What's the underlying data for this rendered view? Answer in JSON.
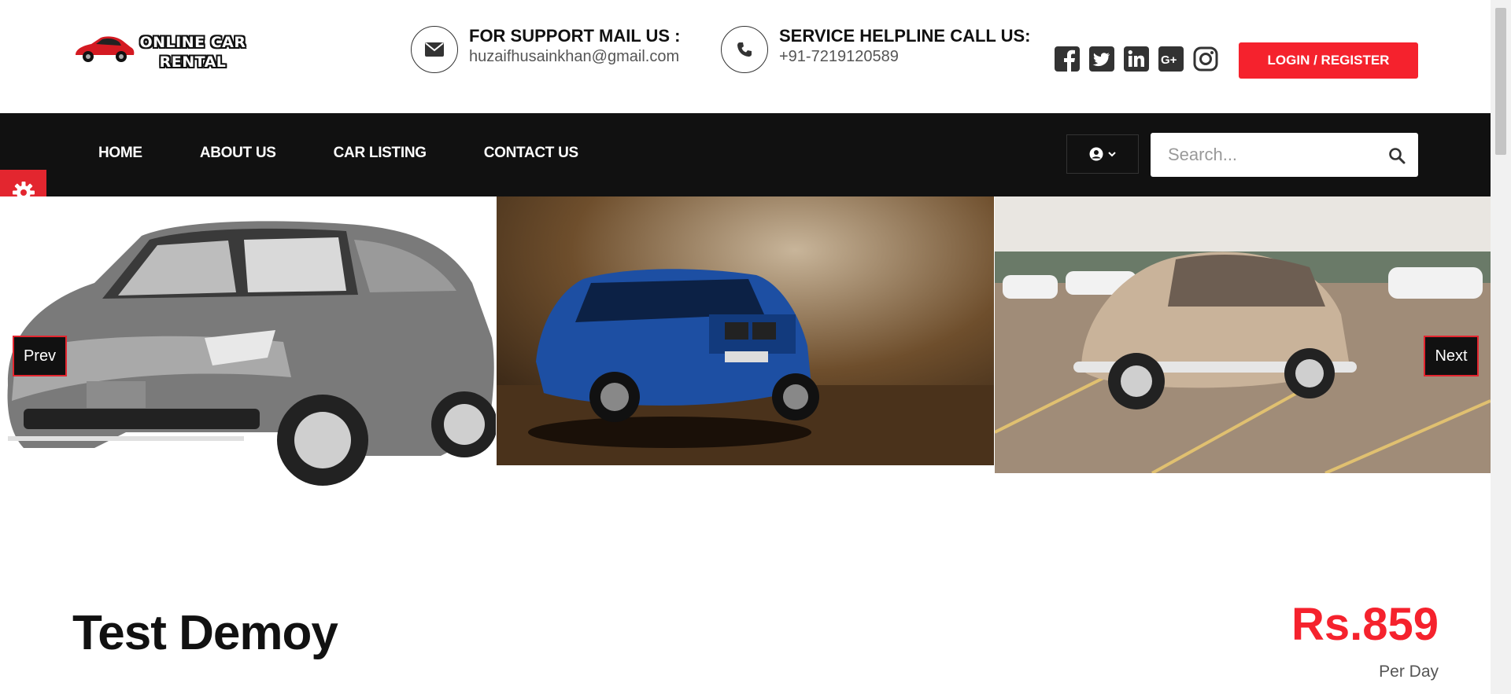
{
  "brand": {
    "logo_line1": "ONLINE CAR",
    "logo_line2": "RENTAL"
  },
  "support": {
    "title": "FOR SUPPORT MAIL US :",
    "email": "huzaifhusainkhan@gmail.com",
    "icon": "envelope-icon"
  },
  "helpline": {
    "title": "SERVICE HELPLINE CALL US:",
    "phone": "+91-7219120589",
    "icon": "phone-icon"
  },
  "socials": [
    "facebook-icon",
    "twitter-icon",
    "linkedin-icon",
    "google-plus-icon",
    "instagram-icon"
  ],
  "login_label": "LOGIN / REGISTER",
  "nav": {
    "items": [
      {
        "label": "HOME"
      },
      {
        "label": "ABOUT US"
      },
      {
        "label": "CAR LISTING"
      },
      {
        "label": "CONTACT US"
      }
    ]
  },
  "search": {
    "placeholder": "Search..."
  },
  "slider": {
    "prev_label": "Prev",
    "next_label": "Next"
  },
  "listing": {
    "title": "Test Demoy",
    "price": "Rs.859",
    "price_unit": "Per Day"
  },
  "colors": {
    "accent": "#f5222d",
    "nav_bg": "#111111",
    "gear_tab": "#e3262f"
  }
}
